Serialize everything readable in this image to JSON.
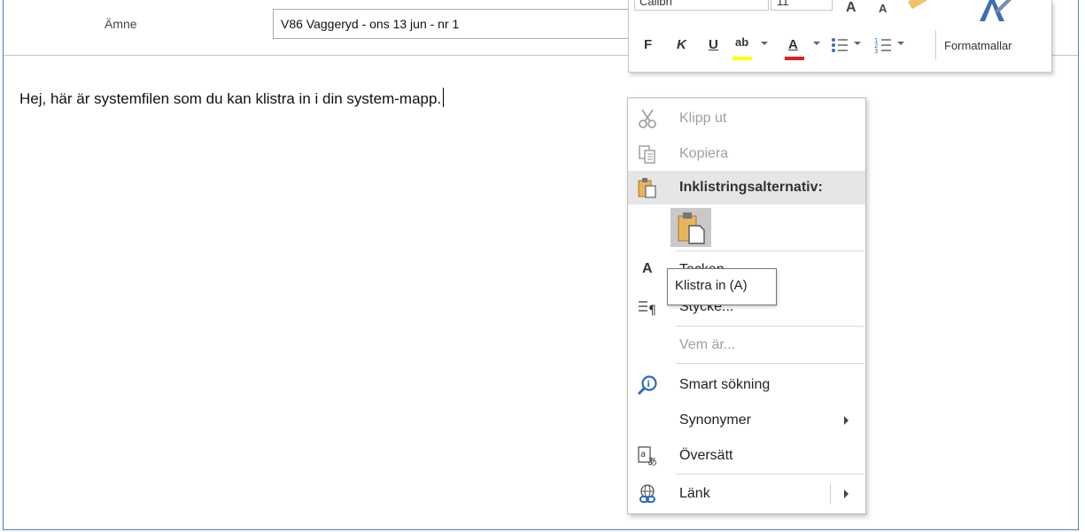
{
  "message": {
    "subject_label": "Ämne",
    "subject_value": "V86 Vaggeryd - ons 13 jun - nr 1",
    "body_text": "Hej, här är systemfilen som du kan klistra in i din system-mapp."
  },
  "mini_toolbar": {
    "font_name": "Calibri",
    "font_size": "11",
    "grow_font": "A",
    "shrink_font": "A",
    "bold": "F",
    "italic": "K",
    "underline": "U",
    "highlight": "ab",
    "font_color": "A",
    "styles_label": "Formatmallar",
    "highlight_color": "#ffff00",
    "font_color_value": "#e02020"
  },
  "context_menu": {
    "cut": "Klipp ut",
    "copy": "Kopiera",
    "paste_options": "Inklistringsalternativ:",
    "font": "Tecken...",
    "paragraph": "Stycke...",
    "who_is": "Vem är...",
    "smart_lookup": "Smart sökning",
    "synonyms": "Synonymer",
    "translate": "Översätt",
    "link": "Länk"
  },
  "tooltip": {
    "text": "Klistra in (A)"
  },
  "colors": {
    "window_border": "#4a7fd0",
    "paste_header_bg": "#e6e6e6",
    "disabled_text": "#a0a0a0"
  }
}
